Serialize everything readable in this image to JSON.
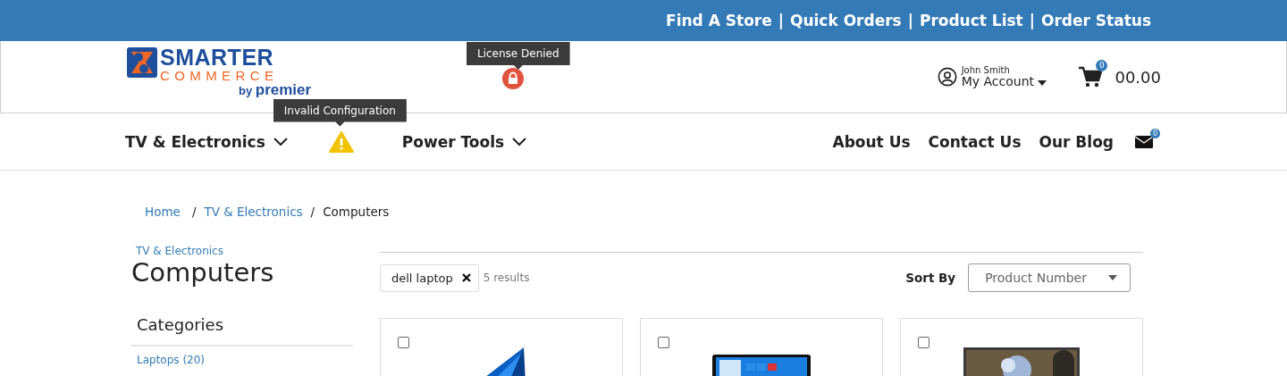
{
  "top_links": {
    "items": [
      "Find A Store",
      "Quick Orders",
      "Product List",
      "Order Status"
    ],
    "separator": "|"
  },
  "header": {
    "logo": {
      "line1": "SMARTER",
      "line2": "COMMERCE",
      "by": "by",
      "brand": "premier"
    },
    "license": {
      "tooltip": "License Denied"
    },
    "account": {
      "user": "John Smith",
      "label": "My Account"
    },
    "cart": {
      "count": "0",
      "total": "00.00"
    }
  },
  "nav": {
    "left": [
      {
        "kind": "dropdown",
        "label": "TV & Electronics"
      },
      {
        "kind": "warning",
        "tooltip": "Invalid Configuration"
      },
      {
        "kind": "dropdown",
        "label": "Power Tools"
      }
    ],
    "right": [
      "About Us",
      "Contact Us",
      "Our Blog"
    ],
    "mail_count": "0"
  },
  "breadcrumb": {
    "separator": "/",
    "items": [
      {
        "label": "Home",
        "link": true
      },
      {
        "label": "TV & Electronics",
        "link": true
      },
      {
        "label": "Computers",
        "link": false
      }
    ]
  },
  "sidebar": {
    "parent": "TV & Electronics",
    "title": "Computers",
    "categories_heading": "Categories",
    "categories": [
      "Laptops (20)"
    ]
  },
  "toolbar": {
    "chip": "dell laptop",
    "results": "5 results",
    "sort_label": "Sort By",
    "sort_value": "Product Number"
  }
}
